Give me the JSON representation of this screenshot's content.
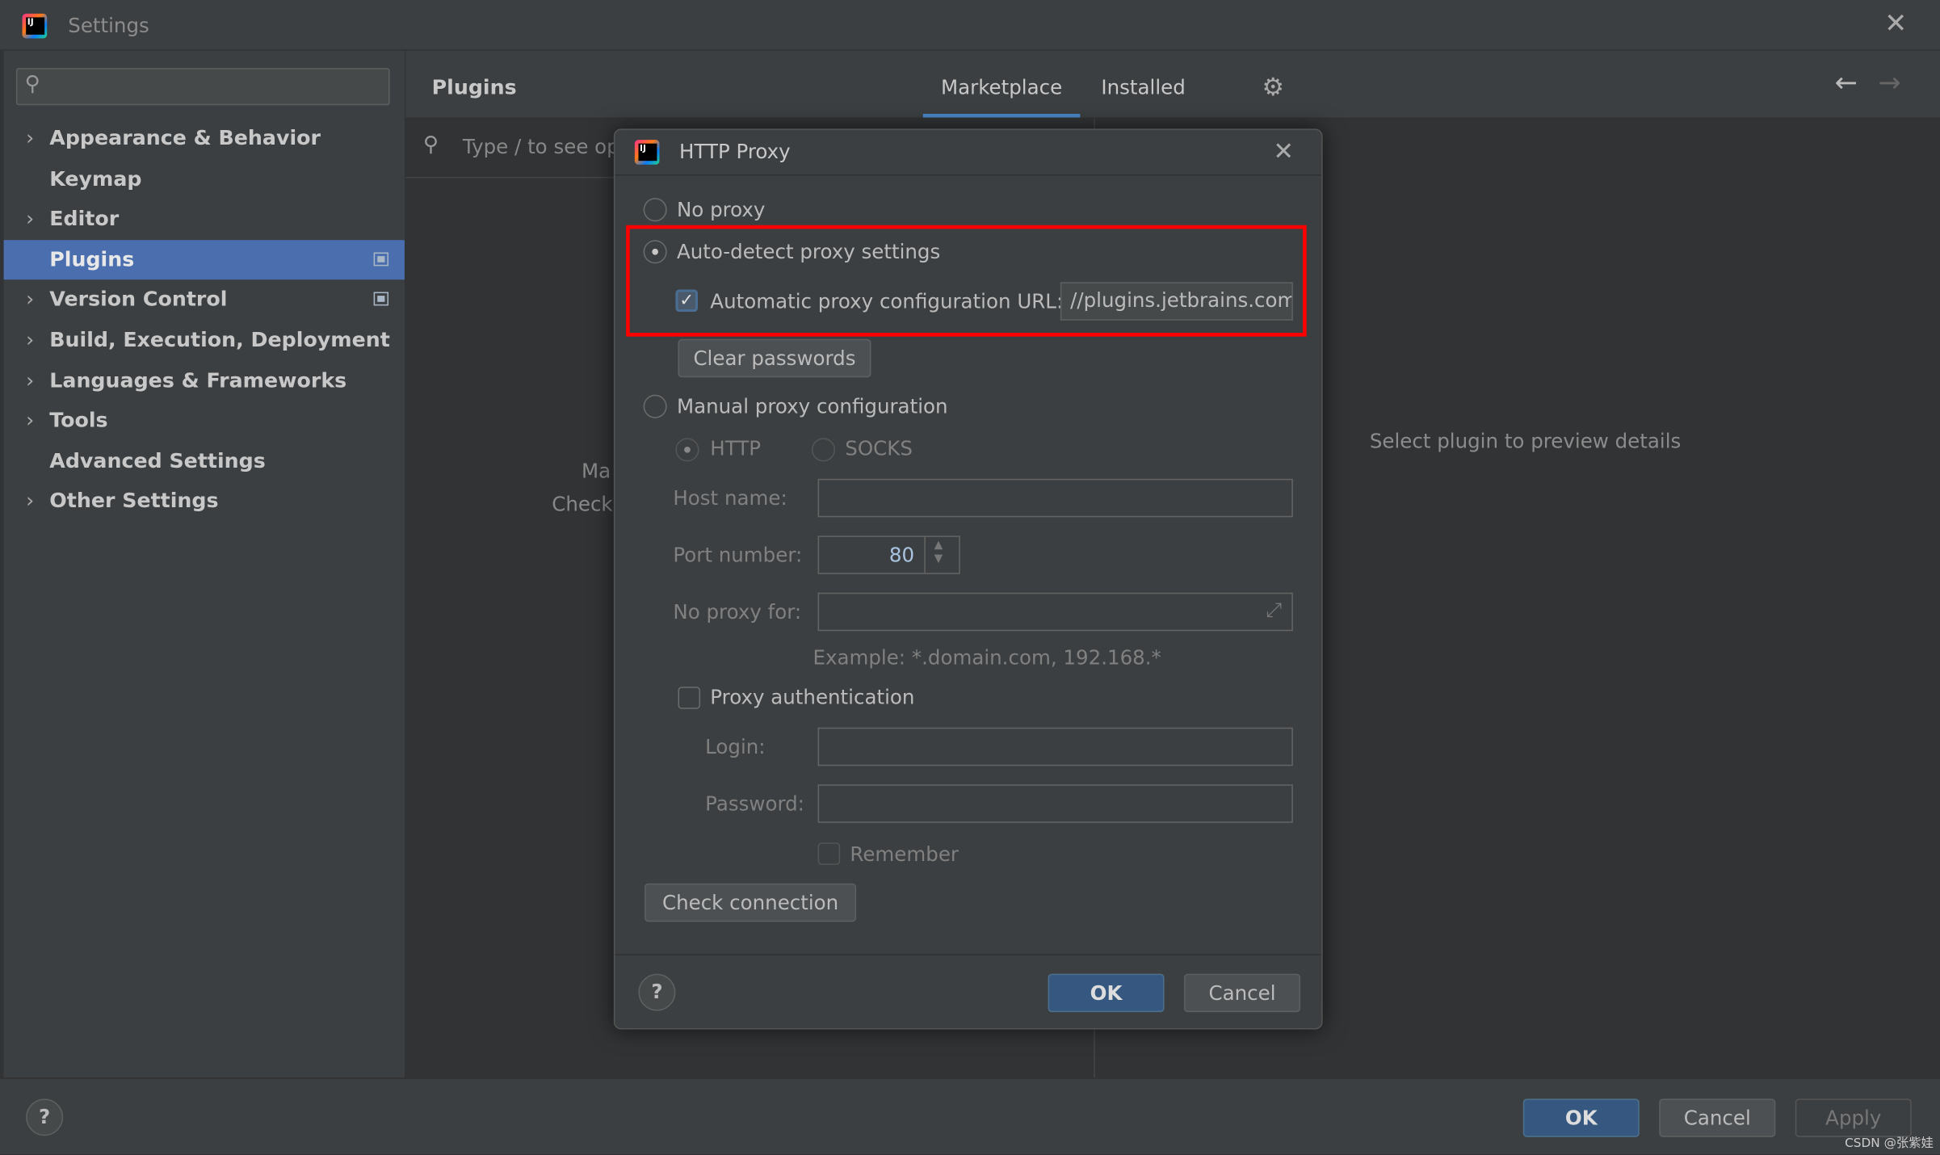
{
  "window": {
    "title": "Settings"
  },
  "sidebar": {
    "search_placeholder": "",
    "items": [
      {
        "label": "Appearance & Behavior",
        "expandable": true
      },
      {
        "label": "Keymap",
        "expandable": false
      },
      {
        "label": "Editor",
        "expandable": true
      },
      {
        "label": "Plugins",
        "expandable": false,
        "selected": true
      },
      {
        "label": "Version Control",
        "expandable": true
      },
      {
        "label": "Build, Execution, Deployment",
        "expandable": true
      },
      {
        "label": "Languages & Frameworks",
        "expandable": true
      },
      {
        "label": "Tools",
        "expandable": true
      },
      {
        "label": "Advanced Settings",
        "expandable": false
      },
      {
        "label": "Other Settings",
        "expandable": true
      }
    ]
  },
  "plugins": {
    "title": "Plugins",
    "tabs": [
      {
        "label": "Marketplace",
        "active": true
      },
      {
        "label": "Installed",
        "active": false
      }
    ],
    "search_placeholder": "Type / to see op",
    "partial_text_1": "Ma",
    "partial_text_2": "Check",
    "empty_details": "Select plugin to preview details"
  },
  "footer": {
    "ok": "OK",
    "cancel": "Cancel",
    "apply": "Apply",
    "help": "?"
  },
  "watermark": "CSDN @张紫娃",
  "dialog": {
    "title": "HTTP Proxy",
    "no_proxy": "No proxy",
    "auto_detect": "Auto-detect proxy settings",
    "auto_url_label": "Automatic proxy configuration URL:",
    "auto_url_checked": true,
    "auto_url_value": "//plugins.jetbrains.com",
    "clear_passwords": "Clear passwords",
    "manual": "Manual proxy configuration",
    "http": "HTTP",
    "socks": "SOCKS",
    "host_label": "Host name:",
    "host_value": "",
    "port_label": "Port number:",
    "port_value": "80",
    "no_proxy_for_label": "No proxy for:",
    "no_proxy_for_value": "",
    "example": "Example: *.domain.com, 192.168.*",
    "proxy_auth": "Proxy authentication",
    "login_label": "Login:",
    "password_label": "Password:",
    "remember": "Remember",
    "check_connection": "Check connection",
    "ok": "OK",
    "cancel": "Cancel",
    "help": "?",
    "selected_mode": "auto_detect"
  },
  "colors": {
    "selection": "#4b6eaf",
    "highlight_box": "#ff0000",
    "primary_button": "#365880"
  }
}
